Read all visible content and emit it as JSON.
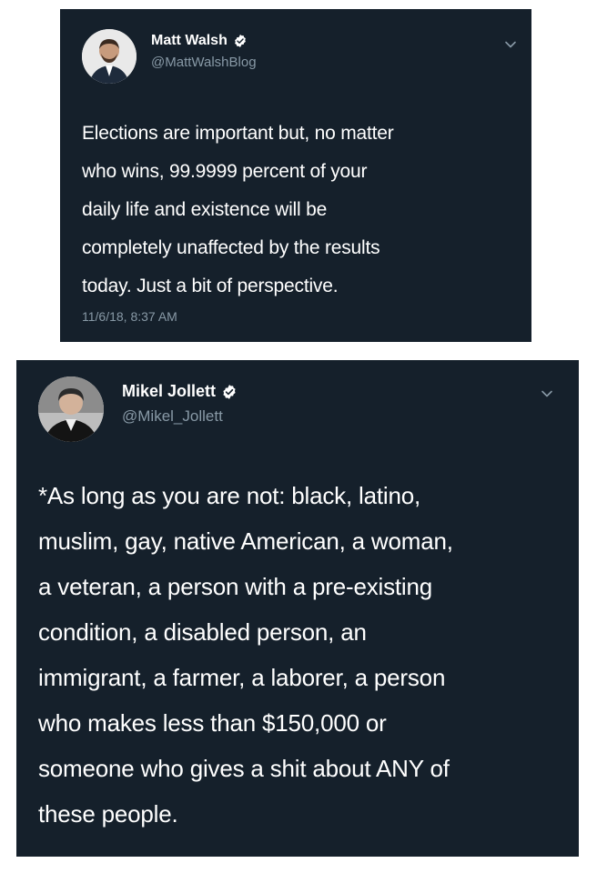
{
  "tweets": [
    {
      "name": "Matt Walsh",
      "handle": "@MattWalshBlog",
      "text": "Elections are important but, no matter\nwho wins, 99.9999 percent of your\ndaily life and existence will be\ncompletely unaffected by the results\ntoday. Just a bit of perspective.",
      "timestamp": "11/6/18, 8:37 AM"
    },
    {
      "name": "Mikel Jollett",
      "handle": "@Mikel_Jollett",
      "text": "*As long as you are not: black, latino,\nmuslim, gay, native American, a woman,\na veteran, a person with a pre-existing\ncondition, a disabled person, an\nimmigrant, a farmer, a laborer, a person\nwho makes less than $150,000 or\nsomeone who gives a shit about ANY of\nthese people."
    }
  ],
  "icons": {
    "verified": "verified-badge-icon",
    "more": "chevron-down-icon"
  },
  "colors": {
    "tweet_background": "#15202b",
    "secondary_text": "#8899a6",
    "primary_text": "#ffffff"
  }
}
